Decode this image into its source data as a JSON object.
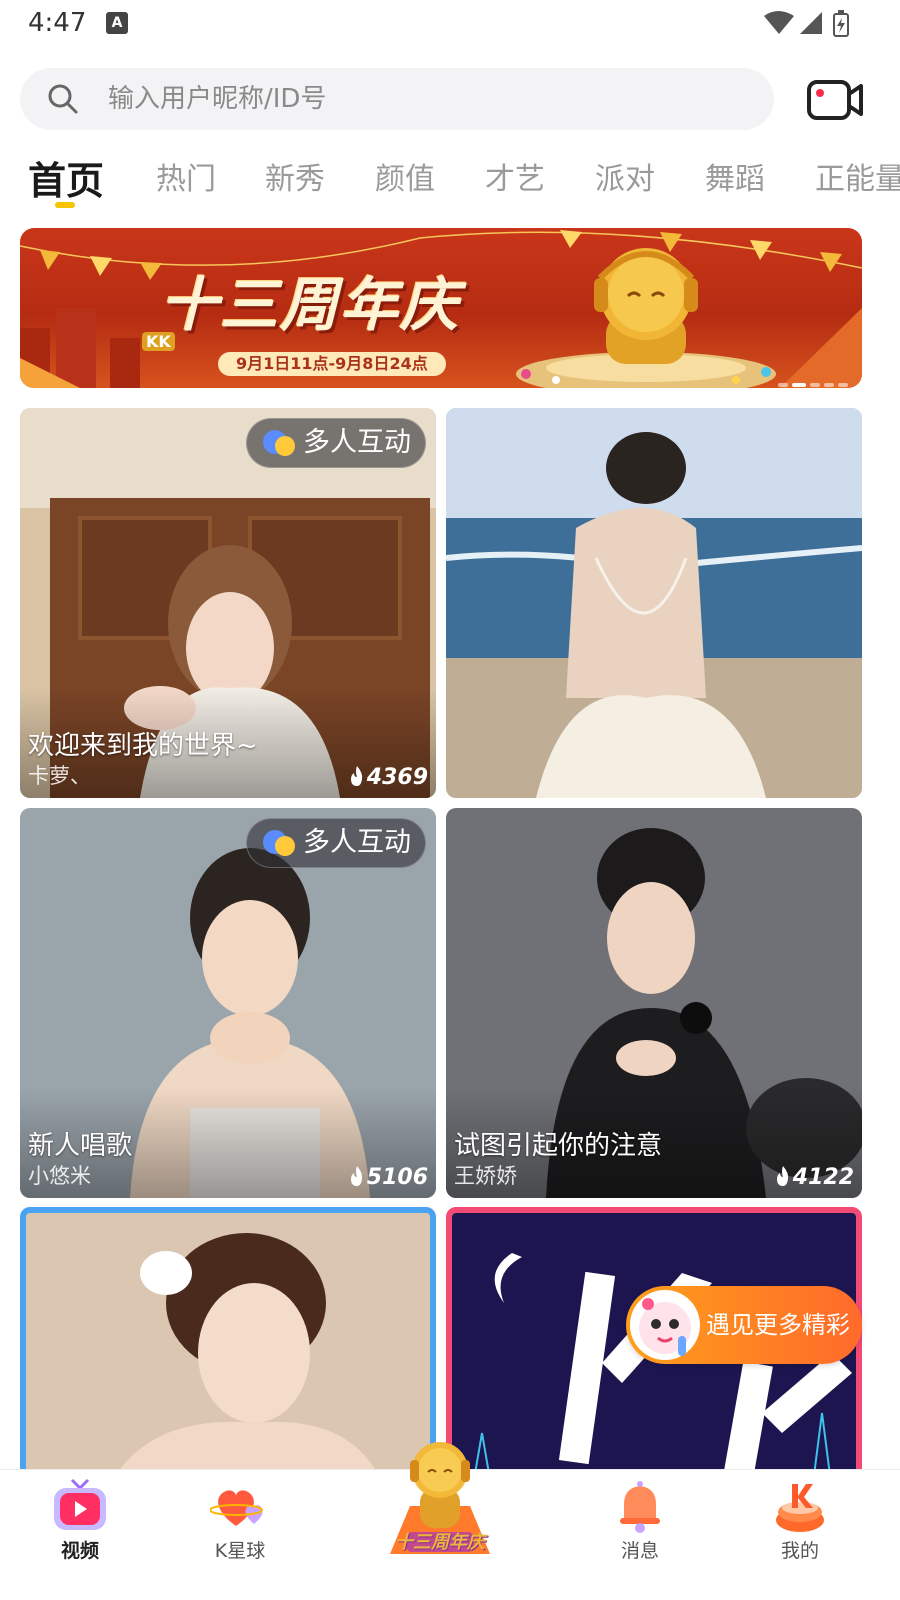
{
  "status_bar": {
    "time": "4:47",
    "indicator": "A"
  },
  "search": {
    "placeholder": "输入用户昵称/ID号"
  },
  "tabs": [
    {
      "label": "首页",
      "active": true
    },
    {
      "label": "热门"
    },
    {
      "label": "新秀"
    },
    {
      "label": "颜值"
    },
    {
      "label": "才艺"
    },
    {
      "label": "派对"
    },
    {
      "label": "舞蹈"
    },
    {
      "label": "正能量"
    }
  ],
  "banner": {
    "title": "十三周年庆",
    "brand": "KK",
    "date_range": "9月1日11点-9月8日24点"
  },
  "feed": [
    {
      "title": "欢迎来到我的世界~",
      "user": "卡萝、",
      "heat": "4369",
      "badge": "多人互动"
    },
    {
      "title": "",
      "user": "",
      "heat": "",
      "badge": ""
    },
    {
      "title": "新人唱歌",
      "user": "小悠米",
      "heat": "5106",
      "badge": "多人互动"
    },
    {
      "title": "试图引起你的注意",
      "user": "王娇娇",
      "heat": "4122",
      "badge": ""
    }
  ],
  "promo": {
    "label": "遇见更多精彩"
  },
  "bottom_nav": [
    {
      "label": "视频",
      "icon": "video-tv-icon",
      "active": true
    },
    {
      "label": "K星球",
      "icon": "heart-planet-icon"
    },
    {
      "label": "十三周年庆",
      "icon": "anniversary-mascot-icon"
    },
    {
      "label": "消息",
      "icon": "bell-icon"
    },
    {
      "label": "我的",
      "icon": "k-cake-icon"
    }
  ],
  "colors": {
    "tab_underline": "#f7c400",
    "promo": "#ff7a26",
    "frame_blue": "#4aa3f0",
    "frame_pink": "#f34b76"
  }
}
